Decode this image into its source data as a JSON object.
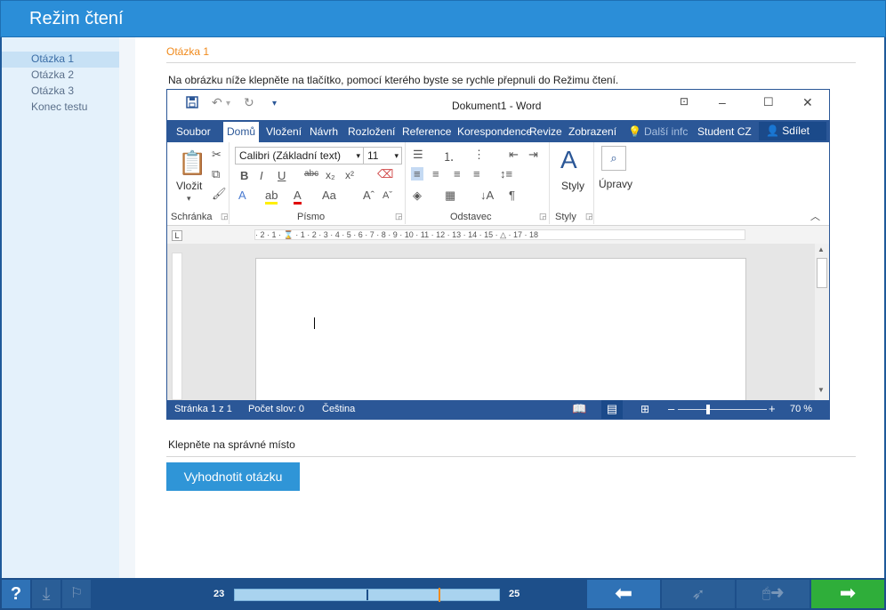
{
  "app": {
    "title": "Režim čtení"
  },
  "nav": {
    "items": [
      {
        "label": "Otázka 1"
      },
      {
        "label": "Otázka 2"
      },
      {
        "label": "Otázka 3"
      },
      {
        "label": "Konec testu"
      }
    ]
  },
  "question": {
    "title": "Otázka 1",
    "text": "Na obrázku níže klepněte na tlačítko, pomocí kterého byste se rychle přepnuli do Režimu čtení.",
    "instruction": "Klepněte na správné místo",
    "evaluate_label": "Vyhodnotit otázku"
  },
  "word": {
    "title": "Dokument1 - Word",
    "tabs": {
      "soubor": "Soubor",
      "domu": "Domů",
      "vlozeni": "Vložení",
      "navrh": "Návrh",
      "rozlozeni": "Rozložení",
      "reference": "Reference",
      "korespondence": "Korespondence",
      "revize": "Revize",
      "zobrazeni": "Zobrazení",
      "dalsi": "Další infc",
      "user": "Student CZ",
      "share": "Sdílet"
    },
    "ribbon": {
      "vlozit": "Vložit",
      "schranka": "Schránka",
      "font_name": "Calibri (Základní text)",
      "font_size": "11",
      "pismo": "Písmo",
      "odstavec": "Odstavec",
      "styly_btn": "Styly",
      "styly": "Styly",
      "upravy": "Úpravy"
    },
    "ruler": "· 2 · 1 · ⌛ · 1 · 2 · 3 · 4 · 5 · 6 · 7 · 8 · 9 · 10 · 11 · 12 · 13 · 14 · 15 · △ · 17 · 18",
    "status": {
      "page": "Stránka 1 z 1",
      "words": "Počet slov: 0",
      "language": "Čeština",
      "zoom": "70 %"
    }
  },
  "progress": {
    "current": "23",
    "total": "25",
    "fraction": 0.77
  }
}
